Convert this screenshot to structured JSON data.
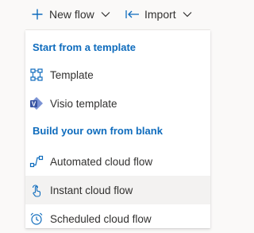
{
  "toolbar": {
    "new_flow_label": "New flow",
    "import_label": "Import",
    "icons": {
      "new_flow": "plus-icon",
      "new_flow_chevron": "chevron-down-icon",
      "import": "import-arrow-icon",
      "import_chevron": "chevron-down-icon"
    }
  },
  "menu": {
    "sections": [
      {
        "header": "Start from a template",
        "items": [
          {
            "label": "Template",
            "icon": "template-icon"
          },
          {
            "label": "Visio template",
            "icon": "visio-icon"
          }
        ]
      },
      {
        "header": "Build your own from blank",
        "items": [
          {
            "label": "Automated cloud flow",
            "icon": "automated-flow-icon"
          },
          {
            "label": "Instant cloud flow",
            "icon": "touch-hand-icon",
            "hovered": true
          },
          {
            "label": "Scheduled cloud flow",
            "icon": "alarm-clock-icon"
          }
        ]
      }
    ]
  },
  "colors": {
    "accent": "#0f6cbd",
    "visio_blue": "#3955a3",
    "hover_bg": "#f3f2f1",
    "toolbar_bg": "#faf9f8"
  }
}
